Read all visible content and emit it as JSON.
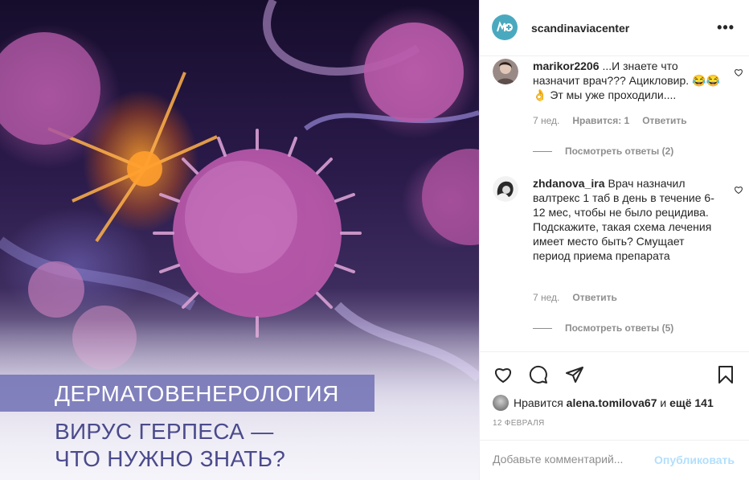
{
  "post": {
    "category": "ДЕРМАТОВЕНЕРОЛОГИЯ",
    "headline_line1": "ВИРУС ГЕРПЕСА —",
    "headline_line2": "ЧТО НУЖНО ЗНАТЬ?"
  },
  "header": {
    "username": "scandinaviacenter",
    "more_icon": "more-horizontal-icon",
    "avatar_icon": "brand-logo-icon"
  },
  "comments": [
    {
      "username": "marikor2206",
      "text": "...И знаете что назначит врач??? Ацикловир. 😂😂👌 Эт мы уже проходили....",
      "age": "7 нед.",
      "likes": "Нравится: 1",
      "reply": "Ответить",
      "view_replies": "Посмотреть ответы (2)"
    },
    {
      "username": "zhdanova_ira",
      "text": "Врач назначил валтрекс 1 таб в день в течение 6-12 мес, чтобы не было рецидива. Подскажите, такая схема лечения имеет место быть? Смущает период приема препарата",
      "age": "7 нед.",
      "reply": "Ответить",
      "view_replies": "Посмотреть ответы (5)"
    }
  ],
  "actions": {
    "like_icon": "heart-icon",
    "comment_icon": "comment-icon",
    "share_icon": "send-icon",
    "save_icon": "bookmark-icon"
  },
  "likes_summary": {
    "prefix": "Нравится",
    "user": "alena.tomilova67",
    "conj": "и",
    "rest": "ещё 141"
  },
  "date": "12 ФЕВРАЛЯ",
  "add_comment": {
    "placeholder": "Добавьте комментарий...",
    "publish_label": "Опубликовать"
  },
  "colors": {
    "accent": "#4aa9bf",
    "publish_disabled": "#b2dffc",
    "category_band": "#7878b9",
    "headline": "#4a4a8c"
  }
}
